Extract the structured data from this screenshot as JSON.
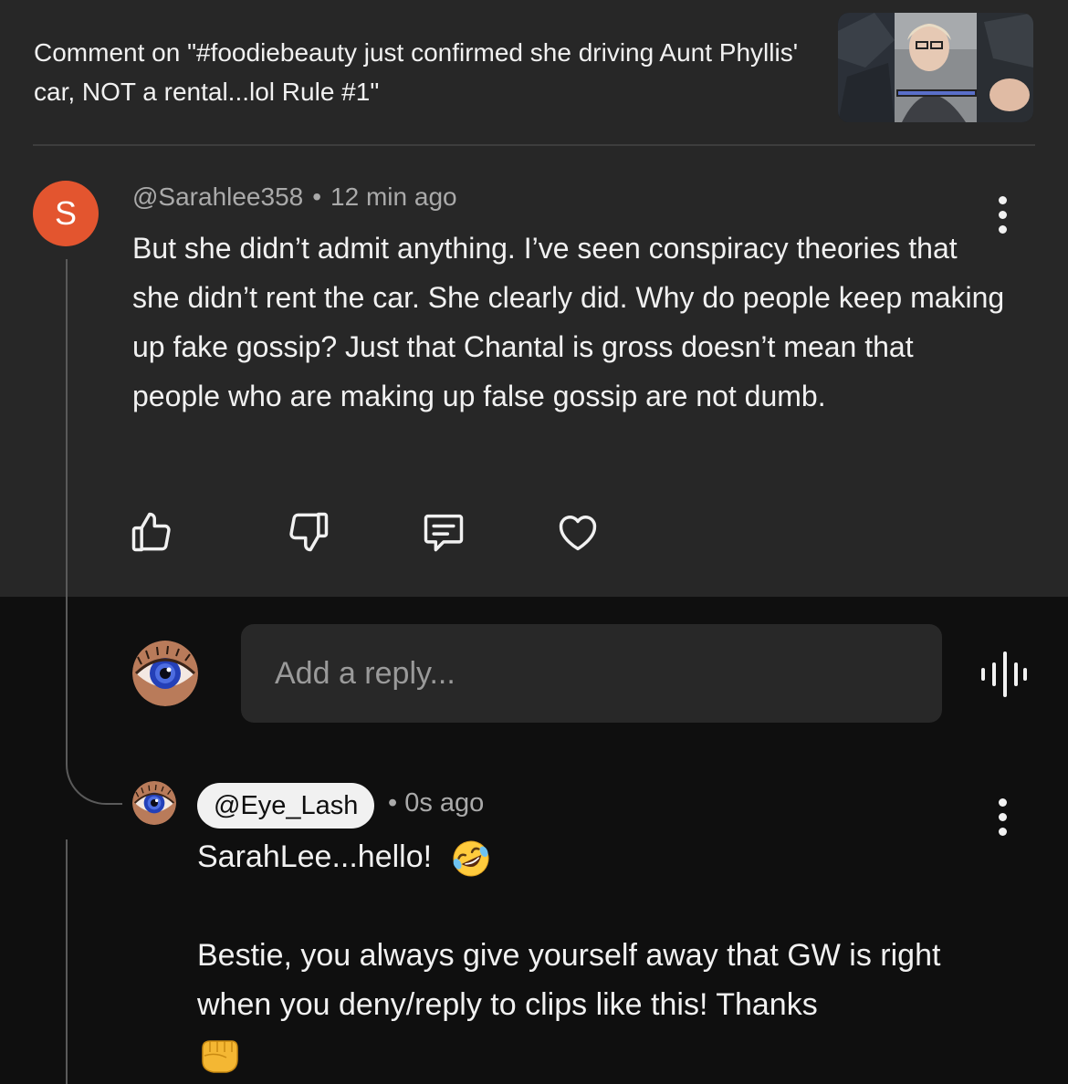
{
  "header": {
    "title": "Comment on \"#foodiebeauty just confirmed she driving Aunt Phyllis' car, NOT a rental...lol Rule #1\""
  },
  "comment": {
    "avatar_letter": "S",
    "author": "@Sarahlee358",
    "separator": "•",
    "time": "12 min ago",
    "text": "But she didn’t admit anything. I’ve seen conspiracy theories that she didn’t rent the car. She clearly did. Why do people keep making up fake gossip? Just that Chantal is gross doesn’t mean that people who are making up false gossip are not dumb.",
    "actions": [
      "thumbs-up-icon",
      "thumbs-down-icon",
      "reply-icon",
      "heart-icon"
    ]
  },
  "reply_box": {
    "placeholder": "Add a reply..."
  },
  "reply": {
    "author": "@Eye_Lash",
    "separator": "•",
    "time": "0s ago",
    "line1": "SarahLee...hello!",
    "line2": "Bestie, you always give yourself away that GW is right when you deny/reply to clips like this! Thanks",
    "emoji1": "rolling-on-floor-laughing-emoji",
    "emoji2": "fist-bump-emoji"
  },
  "colors": {
    "avatar_bg": "#e3552f",
    "top_bg": "#272727",
    "page_bg": "#0f0f0f"
  }
}
